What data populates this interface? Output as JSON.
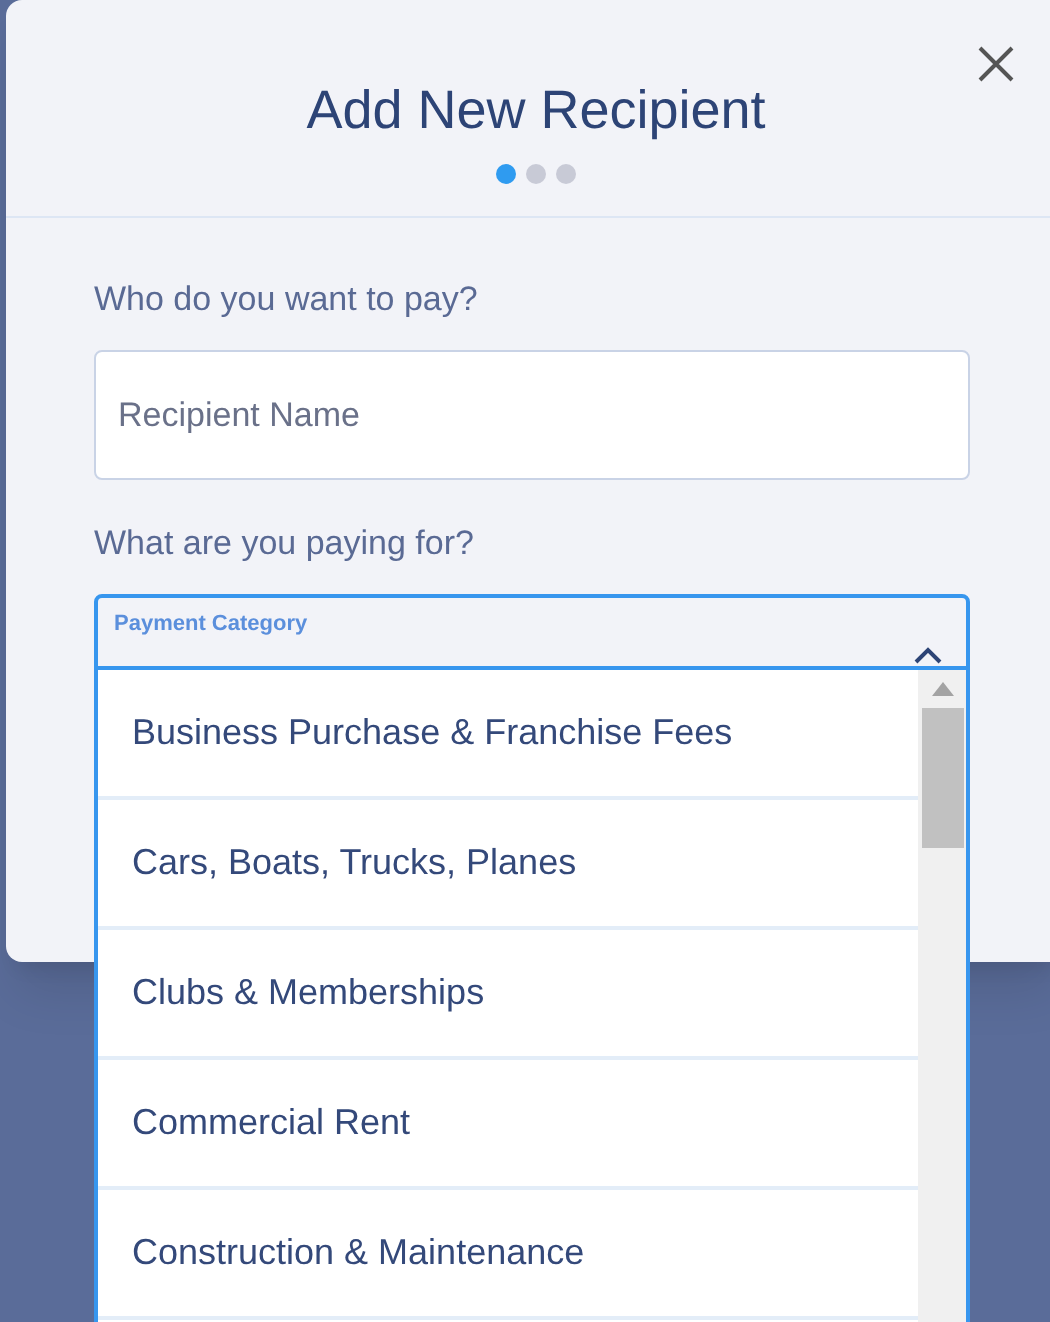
{
  "dialog": {
    "title": "Add New Recipient",
    "steps": [
      {
        "selected": true
      },
      {
        "selected": false
      },
      {
        "selected": false
      }
    ]
  },
  "fields": [
    {
      "label": "Who do you want to pay?",
      "placeholder": "Recipient Name"
    },
    {
      "label": "What are you paying for?",
      "floating_label": "Payment Category",
      "expanded": true
    }
  ],
  "dropdown_options": [
    {
      "label": "Business Purchase & Franchise Fees"
    },
    {
      "label": "Cars, Boats, Trucks, Planes"
    },
    {
      "label": "Clubs & Memberships"
    },
    {
      "label": "Commercial Rent"
    },
    {
      "label": "Construction & Maintenance"
    }
  ]
}
